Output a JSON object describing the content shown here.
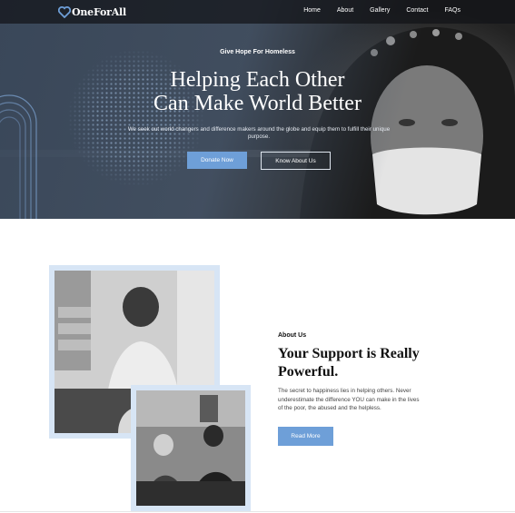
{
  "nav": {
    "logo_text": "OneForAll",
    "links": [
      "Home",
      "About",
      "Gallery",
      "Contact",
      "FAQs"
    ]
  },
  "hero": {
    "tagline": "Give Hope For Homeless",
    "title_line1": "Helping Each Other",
    "title_line2": "Can Make World Better",
    "subtitle": "We seek out world changers and difference makers around the globe and equip them to fulfill their unique purpose.",
    "donate_label": "Donate Now",
    "know_label": "Know About Us"
  },
  "about": {
    "label": "About Us",
    "title": "Your Support is Really Powerful.",
    "text": "The secret to happiness lies in helping others. Never underestimate the difference YOU can make in the lives of the poor, the abused and the helpless.",
    "button_label": "Read More"
  },
  "colors": {
    "accent": "#6e9fd8",
    "frame": "#d7e5f5",
    "nav_bg": "#121418"
  }
}
